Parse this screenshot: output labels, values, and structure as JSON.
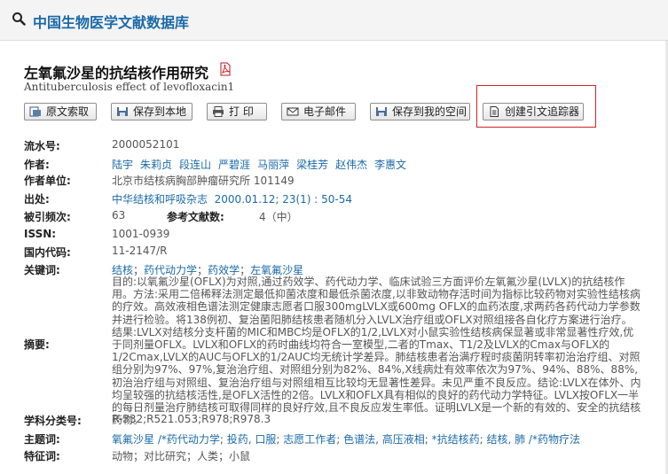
{
  "header": {
    "site_title": "中国生物医学文献数据库"
  },
  "article": {
    "title": "左氧氟沙星的抗结核作用研究",
    "subtitle": "Antituberculosis effect of levofloxacin1"
  },
  "toolbar": {
    "buttons": [
      {
        "label": "原文索取",
        "icon": "document-request-icon"
      },
      {
        "label": "保存到本地",
        "icon": "save-icon"
      },
      {
        "label": "打 印",
        "icon": "printer-icon"
      },
      {
        "label": "电子邮件",
        "icon": "email-icon"
      },
      {
        "label": "保存到我的空间",
        "icon": "save-icon"
      },
      {
        "label": "创建引文追踪器",
        "icon": "document-icon"
      }
    ]
  },
  "fields": {
    "serial": {
      "label": "流水号:",
      "value": "2000052101"
    },
    "authors": {
      "label": "作者:",
      "values": [
        "陆宇",
        "朱莉贞",
        "段连山",
        "严碧涯",
        "马丽萍",
        "梁桂芳",
        "赵伟杰",
        "李惠文"
      ]
    },
    "affiliation": {
      "label": "作者单位:",
      "value": "北京市结核病胸部肿瘤研究所 101149"
    },
    "source": {
      "label": "出处:",
      "journal": "中华结核和呼吸杂志",
      "detail": "2000.01.12; 23(1) : 50-54"
    },
    "cited": {
      "label": "被引频次:",
      "value": "63"
    },
    "refs": {
      "label": "参考文献数:",
      "value": "4（中）"
    },
    "issn": {
      "label": "ISSN:",
      "value": "1001-0939"
    },
    "cn": {
      "label": "国内代码:",
      "value": "11-2147/R"
    },
    "keywords": {
      "label": "关键词:",
      "values": [
        "结核",
        "药代动力学",
        "药效学",
        "左氧氟沙星"
      ],
      "separator": "；"
    },
    "abstract": {
      "label": "摘要:",
      "text": "目的:以氧氟沙星(OFLX)为对照,通过药效学、药代动力学、临床试验三方面评价左氧氟沙星(LVLX)的抗结核作用。方法:采用二倍稀释法测定最低抑菌浓度和最低杀菌浓度,以非致动物存活时间为指标比较药物对实验性结核病的疗效。高效液相色谱法测定健康志愿者口服300mgLVLX或600mg OFLX的血药浓度,求两药各药代动力学参数并进行检验。将138例初、复治菌阳肺结核患者随机分入LVLX治疗组或OFLX对照组接各自化疗方案进行治疗。结果:LVLX对结核分支杆菌的MIC和MBC均是OFLX的1/2,LVLX对小鼠实验性结核病保显著或非常显著性疗效,优于同剂量OFLX。LVLX和OFLX的药时曲线均符合一室模型,二者的Tmax、T1/2及LVLX的Cmax与OFLX的1/2Cmax,LVLX的AUC与OFLX的1/2AUC均无统计学差异。肺结核患者治满疗程时痰菌阴转率初治治疗组、对照组分别为97%、97%,复治治疗组、对照组分别为82%、84%,X线病灶有效率依次为97%、94%、88%、88%,初治治疗组与对照组、复治治疗组与对照组相互比较均无显著性差异。未见严重不良反应。结论:LVLX在体外、内均呈较强的抗结核活性,是OFLX活性的2倍。LVLX和OFLX具有相似的良好的药代动力学特征。LVLX按OFLX一半的每日剂量治疗肺结核可取得同样的良好疗效,且不良反应发生率低。证明LVLX是一个新的有效的、安全的抗结核药物。"
    },
    "classification": {
      "label": "学科分类号:",
      "value": "R-332;R521.053;R978;R978.3"
    },
    "subject": {
      "label": "主题词:",
      "values": [
        "氧氟沙星 /*药代动力学",
        "投药, 口服",
        "志愿工作者",
        "色谱法, 高压液相",
        "*抗结核药",
        "结核, 肺 /*药物疗法"
      ],
      "separator": "; "
    },
    "feature": {
      "label": "特征词:",
      "value": "动物；对比研究；人类；小鼠"
    }
  },
  "colors": {
    "accent": "#1c6aa8",
    "highlight": "#d32424",
    "pdf": "#d9242a"
  }
}
